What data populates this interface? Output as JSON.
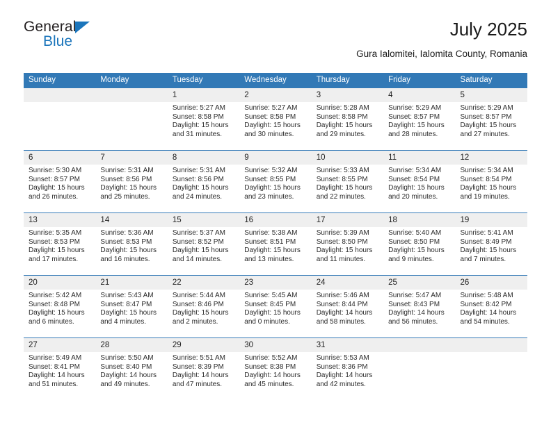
{
  "brand": {
    "name_top": "General",
    "name_bottom": "Blue",
    "triangle_color": "#1b75bb"
  },
  "header": {
    "title": "July 2025",
    "subtitle": "Gura Ialomitei, Ialomita County, Romania"
  },
  "theme": {
    "header_blue": "#3279b6",
    "daynum_gray": "#efefef",
    "text": "#222222"
  },
  "calendar": {
    "weekday_headers": [
      "Sunday",
      "Monday",
      "Tuesday",
      "Wednesday",
      "Thursday",
      "Friday",
      "Saturday"
    ],
    "weeks": [
      [
        {
          "day": "",
          "lines": []
        },
        {
          "day": "",
          "lines": []
        },
        {
          "day": "1",
          "lines": [
            "Sunrise: 5:27 AM",
            "Sunset: 8:58 PM",
            "Daylight: 15 hours",
            "and 31 minutes."
          ]
        },
        {
          "day": "2",
          "lines": [
            "Sunrise: 5:27 AM",
            "Sunset: 8:58 PM",
            "Daylight: 15 hours",
            "and 30 minutes."
          ]
        },
        {
          "day": "3",
          "lines": [
            "Sunrise: 5:28 AM",
            "Sunset: 8:58 PM",
            "Daylight: 15 hours",
            "and 29 minutes."
          ]
        },
        {
          "day": "4",
          "lines": [
            "Sunrise: 5:29 AM",
            "Sunset: 8:57 PM",
            "Daylight: 15 hours",
            "and 28 minutes."
          ]
        },
        {
          "day": "5",
          "lines": [
            "Sunrise: 5:29 AM",
            "Sunset: 8:57 PM",
            "Daylight: 15 hours",
            "and 27 minutes."
          ]
        }
      ],
      [
        {
          "day": "6",
          "lines": [
            "Sunrise: 5:30 AM",
            "Sunset: 8:57 PM",
            "Daylight: 15 hours",
            "and 26 minutes."
          ]
        },
        {
          "day": "7",
          "lines": [
            "Sunrise: 5:31 AM",
            "Sunset: 8:56 PM",
            "Daylight: 15 hours",
            "and 25 minutes."
          ]
        },
        {
          "day": "8",
          "lines": [
            "Sunrise: 5:31 AM",
            "Sunset: 8:56 PM",
            "Daylight: 15 hours",
            "and 24 minutes."
          ]
        },
        {
          "day": "9",
          "lines": [
            "Sunrise: 5:32 AM",
            "Sunset: 8:55 PM",
            "Daylight: 15 hours",
            "and 23 minutes."
          ]
        },
        {
          "day": "10",
          "lines": [
            "Sunrise: 5:33 AM",
            "Sunset: 8:55 PM",
            "Daylight: 15 hours",
            "and 22 minutes."
          ]
        },
        {
          "day": "11",
          "lines": [
            "Sunrise: 5:34 AM",
            "Sunset: 8:54 PM",
            "Daylight: 15 hours",
            "and 20 minutes."
          ]
        },
        {
          "day": "12",
          "lines": [
            "Sunrise: 5:34 AM",
            "Sunset: 8:54 PM",
            "Daylight: 15 hours",
            "and 19 minutes."
          ]
        }
      ],
      [
        {
          "day": "13",
          "lines": [
            "Sunrise: 5:35 AM",
            "Sunset: 8:53 PM",
            "Daylight: 15 hours",
            "and 17 minutes."
          ]
        },
        {
          "day": "14",
          "lines": [
            "Sunrise: 5:36 AM",
            "Sunset: 8:53 PM",
            "Daylight: 15 hours",
            "and 16 minutes."
          ]
        },
        {
          "day": "15",
          "lines": [
            "Sunrise: 5:37 AM",
            "Sunset: 8:52 PM",
            "Daylight: 15 hours",
            "and 14 minutes."
          ]
        },
        {
          "day": "16",
          "lines": [
            "Sunrise: 5:38 AM",
            "Sunset: 8:51 PM",
            "Daylight: 15 hours",
            "and 13 minutes."
          ]
        },
        {
          "day": "17",
          "lines": [
            "Sunrise: 5:39 AM",
            "Sunset: 8:50 PM",
            "Daylight: 15 hours",
            "and 11 minutes."
          ]
        },
        {
          "day": "18",
          "lines": [
            "Sunrise: 5:40 AM",
            "Sunset: 8:50 PM",
            "Daylight: 15 hours",
            "and 9 minutes."
          ]
        },
        {
          "day": "19",
          "lines": [
            "Sunrise: 5:41 AM",
            "Sunset: 8:49 PM",
            "Daylight: 15 hours",
            "and 7 minutes."
          ]
        }
      ],
      [
        {
          "day": "20",
          "lines": [
            "Sunrise: 5:42 AM",
            "Sunset: 8:48 PM",
            "Daylight: 15 hours",
            "and 6 minutes."
          ]
        },
        {
          "day": "21",
          "lines": [
            "Sunrise: 5:43 AM",
            "Sunset: 8:47 PM",
            "Daylight: 15 hours",
            "and 4 minutes."
          ]
        },
        {
          "day": "22",
          "lines": [
            "Sunrise: 5:44 AM",
            "Sunset: 8:46 PM",
            "Daylight: 15 hours",
            "and 2 minutes."
          ]
        },
        {
          "day": "23",
          "lines": [
            "Sunrise: 5:45 AM",
            "Sunset: 8:45 PM",
            "Daylight: 15 hours",
            "and 0 minutes."
          ]
        },
        {
          "day": "24",
          "lines": [
            "Sunrise: 5:46 AM",
            "Sunset: 8:44 PM",
            "Daylight: 14 hours",
            "and 58 minutes."
          ]
        },
        {
          "day": "25",
          "lines": [
            "Sunrise: 5:47 AM",
            "Sunset: 8:43 PM",
            "Daylight: 14 hours",
            "and 56 minutes."
          ]
        },
        {
          "day": "26",
          "lines": [
            "Sunrise: 5:48 AM",
            "Sunset: 8:42 PM",
            "Daylight: 14 hours",
            "and 54 minutes."
          ]
        }
      ],
      [
        {
          "day": "27",
          "lines": [
            "Sunrise: 5:49 AM",
            "Sunset: 8:41 PM",
            "Daylight: 14 hours",
            "and 51 minutes."
          ]
        },
        {
          "day": "28",
          "lines": [
            "Sunrise: 5:50 AM",
            "Sunset: 8:40 PM",
            "Daylight: 14 hours",
            "and 49 minutes."
          ]
        },
        {
          "day": "29",
          "lines": [
            "Sunrise: 5:51 AM",
            "Sunset: 8:39 PM",
            "Daylight: 14 hours",
            "and 47 minutes."
          ]
        },
        {
          "day": "30",
          "lines": [
            "Sunrise: 5:52 AM",
            "Sunset: 8:38 PM",
            "Daylight: 14 hours",
            "and 45 minutes."
          ]
        },
        {
          "day": "31",
          "lines": [
            "Sunrise: 5:53 AM",
            "Sunset: 8:36 PM",
            "Daylight: 14 hours",
            "and 42 minutes."
          ]
        },
        {
          "day": "",
          "lines": []
        },
        {
          "day": "",
          "lines": []
        }
      ]
    ]
  }
}
